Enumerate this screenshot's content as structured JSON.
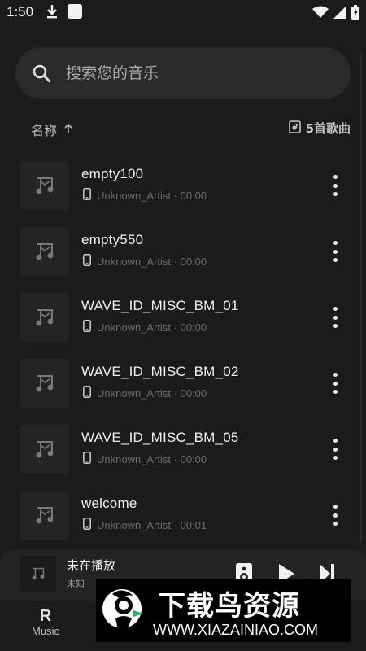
{
  "status_bar": {
    "time": "1:50",
    "icons": [
      "download-icon",
      "notification-square-icon",
      "wifi-icon",
      "signal-icon",
      "battery-icon"
    ]
  },
  "search": {
    "placeholder": "搜索您的音乐",
    "value": ""
  },
  "sort": {
    "label": "名称",
    "direction": "ascending"
  },
  "song_count": "5首歌曲",
  "songs": [
    {
      "title": "empty100",
      "meta": "Unknown_Artist · 00:00"
    },
    {
      "title": "empty550",
      "meta": "Unknown_Artist · 00:00"
    },
    {
      "title": "WAVE_ID_MISC_BM_01",
      "meta": "Unknown_Artist · 00:00"
    },
    {
      "title": "WAVE_ID_MISC_BM_02",
      "meta": "Unknown_Artist · 00:00"
    },
    {
      "title": "WAVE_ID_MISC_BM_05",
      "meta": "Unknown_Artist · 00:00"
    },
    {
      "title": "welcome",
      "meta": "Unknown_Artist · 00:01"
    }
  ],
  "mini_player": {
    "title": "未在播放",
    "subtitle": "未知"
  },
  "bottom_nav": {
    "music_label": "Music",
    "music_icon_letter": "R"
  },
  "watermark": {
    "brand": "下载鸟资源",
    "url": "WWW.XIAZAINIAO.COM"
  },
  "colors": {
    "background": "#1b1b1c",
    "search_bg": "#2a2a2c",
    "card_bg": "#242425",
    "text_primary": "#f0f0f0",
    "text_muted": "#6b6b6b"
  }
}
